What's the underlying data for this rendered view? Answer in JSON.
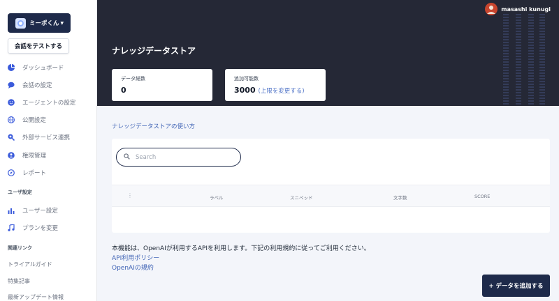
{
  "sidebar": {
    "bot_name": "ミーポくん",
    "test_button": "会話をテストする",
    "nav": [
      {
        "label": "ダッシュボード",
        "icon": "pie-chart-icon"
      },
      {
        "label": "会話の設定",
        "icon": "chat-bubble-icon"
      },
      {
        "label": "エージェントの設定",
        "icon": "smiley-icon"
      },
      {
        "label": "公開設定",
        "icon": "globe-icon"
      },
      {
        "label": "外部サービス連携",
        "icon": "integration-icon"
      },
      {
        "label": "権限管理",
        "icon": "user-circle-icon"
      },
      {
        "label": "レポート",
        "icon": "compass-icon"
      }
    ],
    "user_section": "ユーザ設定",
    "user_nav": [
      {
        "label": "ユーザー設定",
        "icon": "bar-chart-icon"
      },
      {
        "label": "プランを変更",
        "icon": "music-note-icon"
      }
    ],
    "links_section": "関連リンク",
    "links": [
      "トライアルガイド",
      "特集記事",
      "最新アップデート情報"
    ]
  },
  "header": {
    "user_name": "masashi kunugi",
    "title": "ナレッジデータストア",
    "stats": [
      {
        "label": "データ総数",
        "value": "0",
        "link": ""
      },
      {
        "label": "追加可能数",
        "value": "3000",
        "link": "(上限を変更する)"
      }
    ]
  },
  "main": {
    "usage_link": "ナレッジデータストアの使い方",
    "search_placeholder": "Search",
    "columns": [
      "ラベル",
      "スニペッド",
      "文字数",
      "SCORE"
    ],
    "notice": "本機能は、OpenAIが利用するAPIを利用します。下記の利用規約に従ってご利用ください。",
    "links": [
      "API利用ポリシー",
      "OpenAIの規約"
    ],
    "add_button": "+ データを追加する"
  },
  "colors": {
    "header_bg": "#252836",
    "primary": "#1e2a4a",
    "link": "#3f63b5",
    "icon_blue": "#3b5bdb"
  }
}
